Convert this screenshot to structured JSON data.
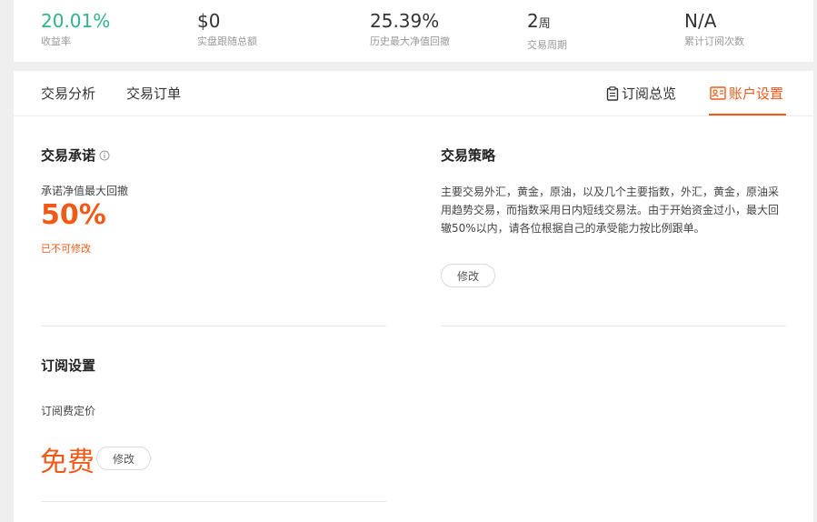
{
  "stats": [
    {
      "value": "20.01%",
      "unit": "",
      "label": "收益率",
      "color": "#2fb38a"
    },
    {
      "value": "$0",
      "unit": "",
      "label": "实盘跟随总额"
    },
    {
      "value": "25.39%",
      "unit": "",
      "label": "历史最大净值回撤"
    },
    {
      "value": "2",
      "unit": "周",
      "label": "交易周期"
    },
    {
      "value": "N/A",
      "unit": "",
      "label": "累计订阅次数"
    }
  ],
  "tabs": {
    "left": [
      {
        "label": "交易分析"
      },
      {
        "label": "交易订单"
      }
    ],
    "right": [
      {
        "label": "订阅总览",
        "icon": "clipboard-icon"
      },
      {
        "label": "账户设置",
        "icon": "account-settings-icon",
        "active": true
      }
    ]
  },
  "commitment": {
    "title": "交易承诺",
    "label": "承诺净值最大回撤",
    "value": "50%",
    "note": "已不可修改"
  },
  "strategy": {
    "title": "交易策略",
    "text": "主要交易外汇，黄金，原油，以及几个主要指数，外汇，黄金，原油采用趋势交易，而指数采用日内短线交易法。由于开始资金过小，最大回辙50%以内，请各位根据自己的承受能力按比例跟单。",
    "edit_label": "修改"
  },
  "subscription": {
    "title": "订阅设置",
    "label": "订阅费定价",
    "value": "免费",
    "edit_label": "修改"
  },
  "colors": {
    "accent": "#f05a19",
    "positive": "#2fb38a"
  }
}
